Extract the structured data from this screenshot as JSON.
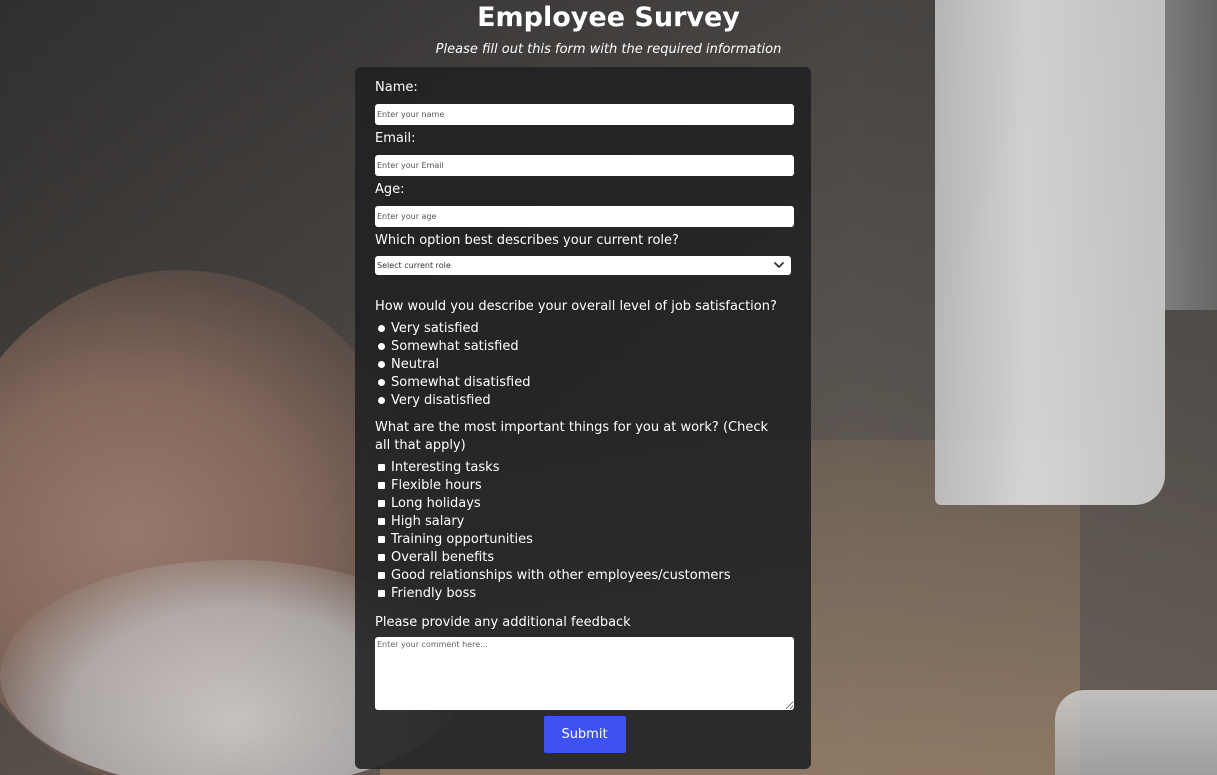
{
  "header": {
    "title": "Employee Survey",
    "subtitle": "Please fill out this form with the required information"
  },
  "form": {
    "name": {
      "label": "Name:",
      "placeholder": "Enter your name",
      "value": ""
    },
    "email": {
      "label": "Email:",
      "placeholder": "Enter your Email",
      "value": ""
    },
    "age": {
      "label": "Age:",
      "placeholder": "Enter your age",
      "value": ""
    },
    "role": {
      "label": "Which option best describes your current role?",
      "selected": "Select current role",
      "icon": "chevron-down-icon"
    },
    "satisfaction": {
      "question": "How would you describe your overall level of job satisfaction?",
      "options": [
        "Very satisfied",
        "Somewhat satisfied",
        "Neutral",
        "Somewhat disatisfied",
        "Very disatisfied"
      ]
    },
    "important": {
      "question": "What are the most important things for you at work? (Check all that apply)",
      "options": [
        "Interesting tasks",
        "Flexible hours",
        "Long holidays",
        "High salary",
        "Training opportunities",
        "Overall benefits",
        "Good relationships with other employees/customers",
        "Friendly boss"
      ]
    },
    "feedback": {
      "label": "Please provide any additional feedback",
      "placeholder": "Enter your comment here..."
    },
    "submit_label": "Submit"
  },
  "colors": {
    "card_bg": "#202022",
    "submit_bg": "#3d52f0",
    "text": "#ffffff"
  }
}
